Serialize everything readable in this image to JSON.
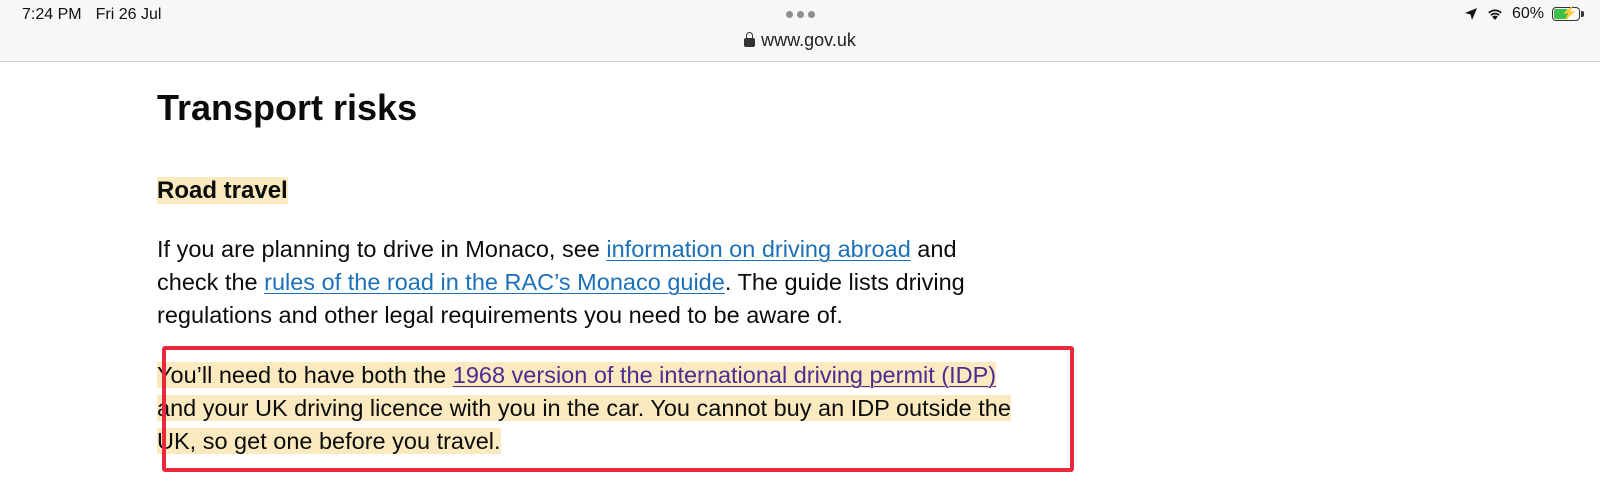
{
  "status_bar": {
    "time": "7:24 PM",
    "date": "Fri 26 Jul",
    "url": "www.gov.uk",
    "battery_percent": "60%",
    "battery_level": 0.6,
    "battery_color": "#3cc14a"
  },
  "page": {
    "heading": "Transport risks",
    "subheading": "Road travel",
    "para1": {
      "text_a": "If you are planning to drive in Monaco, see ",
      "link1": "information on driving abroad",
      "text_b": " and check the ",
      "link2": "rules of the road in the RAC’s Monaco guide",
      "text_c": ". The guide lists driving regulations and other legal requirements you need to be aware of."
    },
    "para2": {
      "text_a": "You’ll need to have both the ",
      "link": "1968 version of the international driving permit (IDP)",
      "text_b": " and your UK driving licence with you in the car. You cannot buy an IDP outside the UK, so get one before you travel."
    }
  },
  "colors": {
    "highlight": "#fbeabf",
    "link": "#1d70b8",
    "visited_link": "#4c2c92",
    "annotation_box": "#e8293d"
  }
}
